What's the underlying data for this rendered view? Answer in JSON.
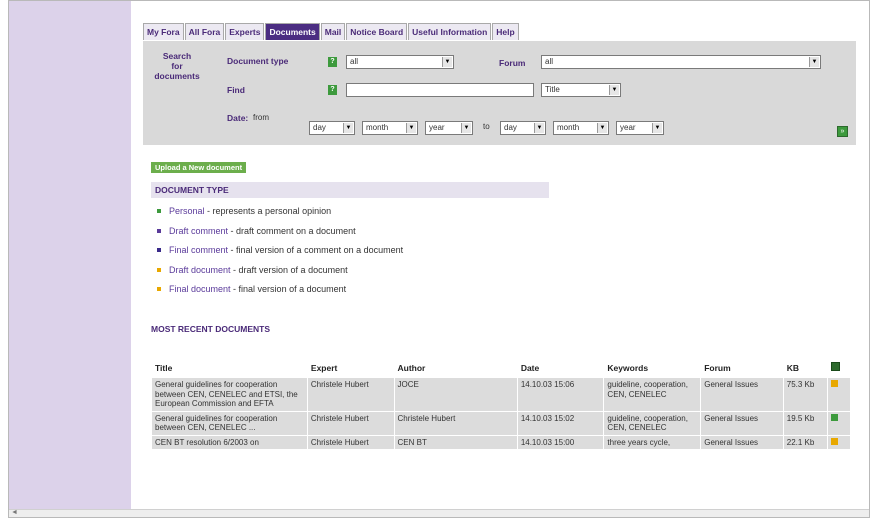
{
  "tabs": [
    "My Fora",
    "All Fora",
    "Experts",
    "Documents",
    "Mail",
    "Notice Board",
    "Useful Information",
    "Help"
  ],
  "active_tab": "Documents",
  "search": {
    "title_lines": [
      "Search",
      "for",
      "documents"
    ],
    "document_type_label": "Document type",
    "document_type_value": "all",
    "forum_label": "Forum",
    "forum_value": "all",
    "find_label": "Find",
    "find_value": "",
    "find_in_value": "Title",
    "date_label": "Date:",
    "from_label": "from",
    "to_label": "to",
    "from_day": "day",
    "from_month": "month",
    "from_year": "year",
    "to_day": "day",
    "to_month": "month",
    "to_year": "year",
    "help_glyph": "?"
  },
  "upload_label": "Upload a New document",
  "document_type": {
    "heading": "DOCUMENT TYPE",
    "items": [
      {
        "name": "Personal",
        "desc": " - represents a personal opinion",
        "color": "#3d9a3d"
      },
      {
        "name": "Draft comment",
        "desc": " - draft comment on a document",
        "color": "#5a3a9a"
      },
      {
        "name": "Final comment",
        "desc": " - final version of a comment on a document",
        "color": "#3a2a8a"
      },
      {
        "name": "Draft document",
        "desc": " - draft version of a document",
        "color": "#e8a800"
      },
      {
        "name": "Final document",
        "desc": " - final version of a document",
        "color": "#e8a800"
      }
    ]
  },
  "recent_heading": "MOST RECENT DOCUMENTS",
  "table": {
    "headers": [
      "Title",
      "Expert",
      "Author",
      "Date",
      "Keywords",
      "Forum",
      "KB"
    ],
    "rows": [
      {
        "title": "General guidelines for cooperation between CEN, CENELEC and ETSI, the European Commission and EFTA",
        "expert": "Christele Hubert",
        "author": "JOCE",
        "date": "14.10.03 15:06",
        "keywords": "guideline, cooperation, CEN, CENELEC",
        "forum": "General Issues",
        "kb": "75.3 Kb",
        "type_color": "#e8a800"
      },
      {
        "title": "General guidelines for cooperation between CEN, CENELEC ...",
        "expert": "Christele Hubert",
        "author": "Christele Hubert",
        "date": "14.10.03 15:02",
        "keywords": "guideline, cooperation, CEN, CENELEC",
        "forum": "General Issues",
        "kb": "19.5 Kb",
        "type_color": "#3d9a3d"
      },
      {
        "title": "CEN BT resolution 6/2003 on",
        "expert": "Christele Hubert",
        "author": "CEN BT",
        "date": "14.10.03 15:00",
        "keywords": "three years cycle,",
        "forum": "General Issues",
        "kb": "22.1 Kb",
        "type_color": "#e8a800"
      }
    ]
  }
}
